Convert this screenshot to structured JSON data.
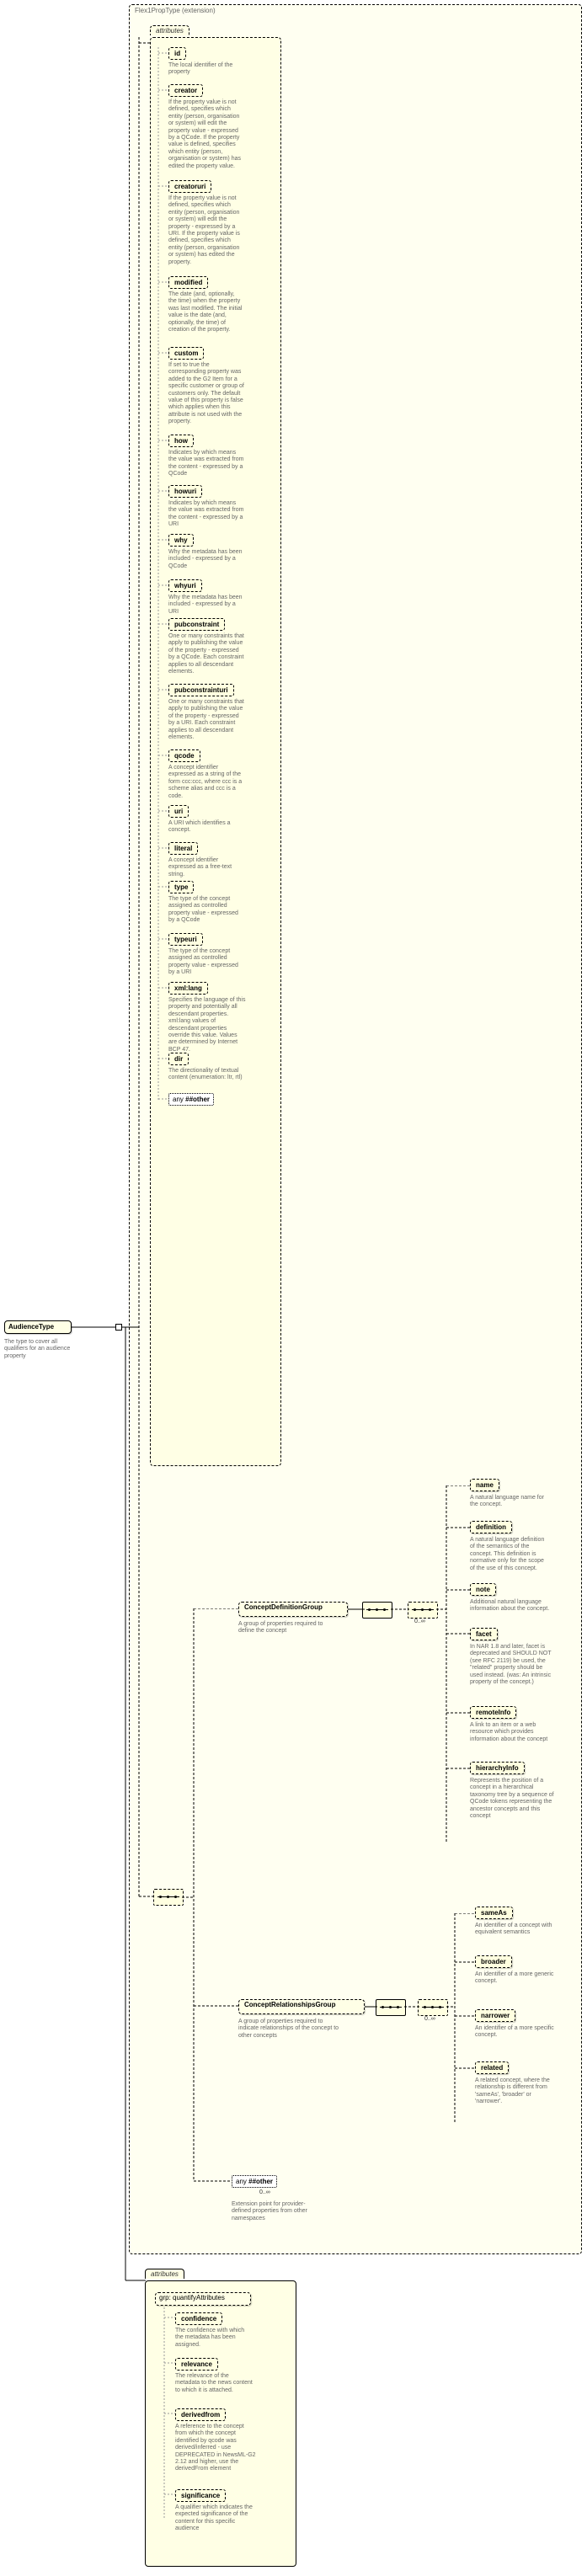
{
  "root": {
    "name": "AudienceType",
    "desc": "The type to cover all qualifiers for an audience property"
  },
  "extension": {
    "type_text": "Flex1PropType (extension)",
    "attr_label": "attributes",
    "attr_label2": "attributes",
    "grp_label": "grp: quantifyAttributes",
    "attrs": {
      "id": {
        "name": "id",
        "desc": "The local identifier of the property"
      },
      "creator": {
        "name": "creator",
        "desc": "If the property value is not defined, specifies which entity (person, organisation or system) will edit the property value - expressed by a QCode. If the property value is defined, specifies which entity (person, organisation or system) has edited the property value."
      },
      "creatoruri": {
        "name": "creatoruri",
        "desc": "If the property value is not defined, specifies which entity (person, organisation or system) will edit the property - expressed by a URI. If the property value is defined, specifies which entity (person, organisation or system) has edited the property."
      },
      "modified": {
        "name": "modified",
        "desc": "The date (and, optionally, the time) when the property was last modified. The initial value is the date (and, optionally, the time) of creation of the property."
      },
      "custom": {
        "name": "custom",
        "desc": "If set to true the corresponding property was added to the G2 Item for a specific customer or group of customers only. The default value of this property is false which applies when this attribute is not used with the property."
      },
      "how": {
        "name": "how",
        "desc": "Indicates by which means the value was extracted from the content - expressed by a QCode"
      },
      "howuri": {
        "name": "howuri",
        "desc": "Indicates by which means the value was extracted from the content - expressed by a URI"
      },
      "why": {
        "name": "why",
        "desc": "Why the metadata has been included - expressed by a QCode"
      },
      "whyuri": {
        "name": "whyuri",
        "desc": "Why the metadata has been included - expressed by a URI"
      },
      "pubconstraint": {
        "name": "pubconstraint",
        "desc": "One or many constraints that apply to publishing the value of the property - expressed by a QCode. Each constraint applies to all descendant elements."
      },
      "pubconstrainturi": {
        "name": "pubconstrainturi",
        "desc": "One or many constraints that apply to publishing the value of the property - expressed by a URI. Each constraint applies to all descendant elements."
      },
      "qcode": {
        "name": "qcode",
        "desc": "A concept identifier expressed as a string of the form ccc:ccc, where ccc is a scheme alias and ccc is a code."
      },
      "uri": {
        "name": "uri",
        "desc": "A URI which identifies a concept."
      },
      "literal": {
        "name": "literal",
        "desc": "A concept identifier expressed as a free-text string."
      },
      "type": {
        "name": "type",
        "desc": "The type of the concept assigned as controlled property value - expressed by a QCode"
      },
      "typeuri": {
        "name": "typeuri",
        "desc": "The type of the concept assigned as controlled property value - expressed by a URI"
      },
      "xmllang": {
        "name": "xml:lang",
        "desc": "Specifies the language of this property and potentially all descendant properties. xml:lang values of descendant properties override this value. Values are determined by Internet BCP 47."
      },
      "dir": {
        "name": "dir",
        "desc": "The directionality of textual content (enumeration: ltr, rtl)"
      },
      "any_other": {
        "name": "##other"
      }
    },
    "def_group": {
      "name": "ConceptDefinitionGroup",
      "desc": "A group of properties required to define the concept",
      "children": {
        "name": {
          "name": "name",
          "desc": "A natural language name for the concept."
        },
        "definition": {
          "name": "definition",
          "desc": "A natural language definition of the semantics of the concept. This definition is normative only for the scope of the use of this concept."
        },
        "note": {
          "name": "note",
          "desc": "Additional natural language information about the concept."
        },
        "facet": {
          "name": "facet",
          "desc": "In NAR 1.8 and later, facet is deprecated and SHOULD NOT (see RFC 2119) be used, the \"related\" property should be used instead. (was: An intrinsic property of the concept.)"
        },
        "remoteInfo": {
          "name": "remoteInfo",
          "desc": "A link to an item or a web resource which provides information about the concept"
        },
        "hierarchyInfo": {
          "name": "hierarchyInfo",
          "desc": "Represents the position of a concept in a hierarchical taxonomy tree by a sequence of QCode tokens representing the ancestor concepts and this concept"
        }
      }
    },
    "rel_group": {
      "name": "ConceptRelationshipsGroup",
      "desc": "A group of properties required to indicate relationships of the concept to other concepts",
      "children": {
        "sameAs": {
          "name": "sameAs",
          "desc": "An identifier of a concept with equivalent semantics"
        },
        "broader": {
          "name": "broader",
          "desc": "An identifier of a more generic concept."
        },
        "narrower": {
          "name": "narrower",
          "desc": "An identifier of a more specific concept."
        },
        "related": {
          "name": "related",
          "desc": "A related concept, where the relationship is different from 'sameAs', 'broader' or 'narrower'."
        }
      }
    },
    "any_other2": {
      "name": "##other",
      "desc": "Extension point for provider-defined properties from other namespaces"
    },
    "qattrs": {
      "confidence": {
        "name": "confidence",
        "desc": "The confidence with which the metadata has been assigned."
      },
      "relevance": {
        "name": "relevance",
        "desc": "The relevance of the metadata to the news content to which it is attached."
      },
      "derivedfrom": {
        "name": "derivedfrom",
        "desc": "A reference to the concept from which the concept identified by qcode was derived/inferred - use DEPRECATED in NewsML-G2 2.12 and higher, use the derivedFrom element"
      },
      "significance": {
        "name": "significance",
        "desc": "A qualifier which indicates the expected significance of the content for this specific audience"
      }
    }
  },
  "occ": {
    "zero_inf": "0..∞"
  }
}
